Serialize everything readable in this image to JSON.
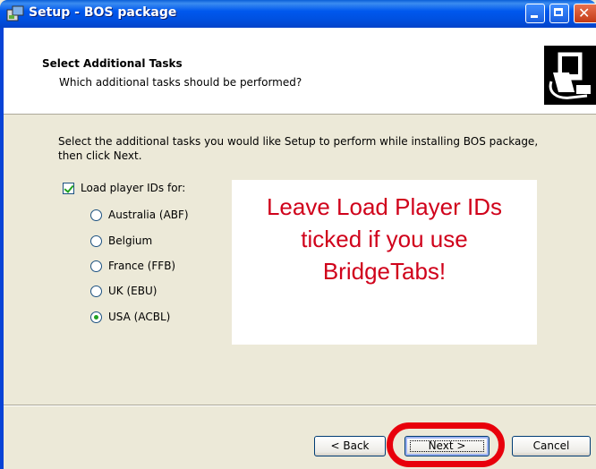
{
  "window": {
    "title": "Setup - BOS package"
  },
  "header": {
    "title": "Select Additional Tasks",
    "subtitle": "Which additional tasks should be performed?"
  },
  "content": {
    "description": "Select the additional tasks you would like Setup to perform while installing BOS package, then click Next.",
    "checkbox": {
      "label": "Load player IDs for:",
      "checked": true
    },
    "radios": [
      {
        "label": "Australia (ABF)",
        "selected": false
      },
      {
        "label": "Belgium",
        "selected": false
      },
      {
        "label": "France (FFB)",
        "selected": false
      },
      {
        "label": "UK (EBU)",
        "selected": false
      },
      {
        "label": "USA (ACBL)",
        "selected": true
      }
    ]
  },
  "annotation": {
    "lines": [
      "Leave Load Player IDs",
      "ticked if you use",
      "BridgeTabs!"
    ],
    "color": "#d0021b"
  },
  "buttons": {
    "back": "< Back",
    "next": "Next >",
    "cancel": "Cancel"
  },
  "colors": {
    "titlebar": "#0058ee",
    "highlight_ring": "#e8000b"
  }
}
